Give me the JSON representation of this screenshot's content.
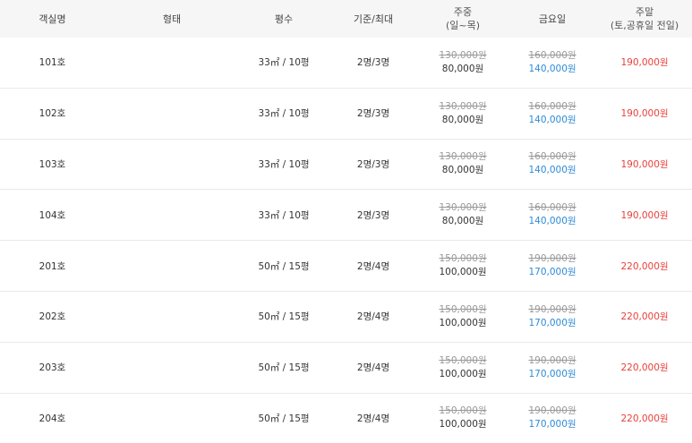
{
  "table": {
    "headers": {
      "room_name": "객실명",
      "type": "형태",
      "size": "평수",
      "capacity": "기준/최대",
      "weekday": "주중",
      "weekday_sub": "(일~목)",
      "friday": "금요일",
      "weekend": "주말",
      "weekend_sub": "(토,공휴일 전일)"
    },
    "rows": [
      {
        "name": "101호",
        "type": "",
        "size": "33㎡ / 10평",
        "capacity": "2명/3명",
        "weekday_old": "130,000원",
        "weekday_new": "80,000원",
        "friday_old": "160,000원",
        "friday_new": "140,000원",
        "weekend": "190,000원"
      },
      {
        "name": "102호",
        "type": "",
        "size": "33㎡ / 10평",
        "capacity": "2명/3명",
        "weekday_old": "130,000원",
        "weekday_new": "80,000원",
        "friday_old": "160,000원",
        "friday_new": "140,000원",
        "weekend": "190,000원"
      },
      {
        "name": "103호",
        "type": "",
        "size": "33㎡ / 10평",
        "capacity": "2명/3명",
        "weekday_old": "130,000원",
        "weekday_new": "80,000원",
        "friday_old": "160,000원",
        "friday_new": "140,000원",
        "weekend": "190,000원"
      },
      {
        "name": "104호",
        "type": "",
        "size": "33㎡ / 10평",
        "capacity": "2명/3명",
        "weekday_old": "130,000원",
        "weekday_new": "80,000원",
        "friday_old": "160,000원",
        "friday_new": "140,000원",
        "weekend": "190,000원"
      },
      {
        "name": "201호",
        "type": "",
        "size": "50㎡ / 15평",
        "capacity": "2명/4명",
        "weekday_old": "150,000원",
        "weekday_new": "100,000원",
        "friday_old": "190,000원",
        "friday_new": "170,000원",
        "weekend": "220,000원"
      },
      {
        "name": "202호",
        "type": "",
        "size": "50㎡ / 15평",
        "capacity": "2명/4명",
        "weekday_old": "150,000원",
        "weekday_new": "100,000원",
        "friday_old": "190,000원",
        "friday_new": "170,000원",
        "weekend": "220,000원"
      },
      {
        "name": "203호",
        "type": "",
        "size": "50㎡ / 15평",
        "capacity": "2명/4명",
        "weekday_old": "150,000원",
        "weekday_new": "100,000원",
        "friday_old": "190,000원",
        "friday_new": "170,000원",
        "weekend": "220,000원"
      },
      {
        "name": "204호",
        "type": "",
        "size": "50㎡ / 15평",
        "capacity": "2명/4명",
        "weekday_old": "150,000원",
        "weekday_new": "100,000원",
        "friday_old": "190,000원",
        "friday_new": "170,000원",
        "weekend": "220,000원"
      }
    ]
  },
  "colors": {
    "header_bg": "#f6f6f6",
    "friday_price": "#2f8ad6",
    "weekend_price": "#e8403a",
    "old_price": "#999999"
  }
}
